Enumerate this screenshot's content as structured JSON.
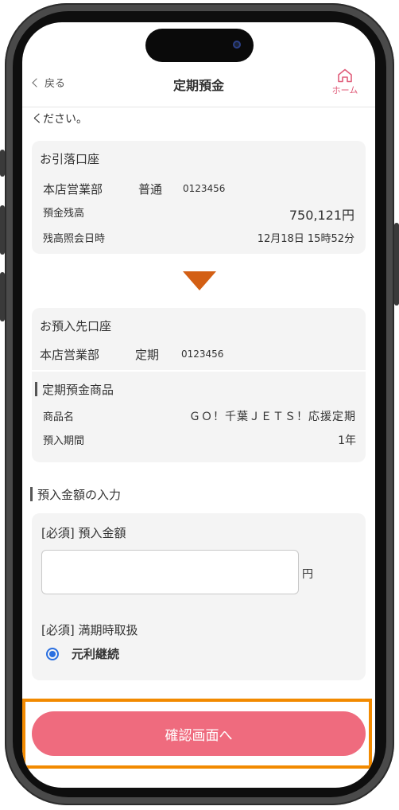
{
  "header": {
    "back_label": "戻る",
    "title": "定期預金",
    "home_label": "ホーム"
  },
  "lead_text": "ください。",
  "withdrawal": {
    "title": "お引落口座",
    "branch": "本店営業部",
    "account_type": "普通",
    "account_number": "0123456",
    "balance_label": "預金残高",
    "balance_value": "750,121円",
    "balance_time_label": "残高照会日時",
    "balance_time_value": "12月18日 15時52分"
  },
  "deposit_account": {
    "title": "お預入先口座",
    "branch": "本店営業部",
    "account_type": "定期",
    "account_number": "0123456"
  },
  "product": {
    "section_title": "定期預金商品",
    "name_label": "商品名",
    "name_value": "ＧＯ！千葉ＪＥＴＳ！応援定期",
    "period_label": "預入期間",
    "period_value": "1年"
  },
  "amount_section": {
    "section_title": "預入金額の入力",
    "required_tag": "[必須]",
    "amount_label": "預入金額",
    "amount_value": "",
    "amount_unit": "円",
    "maturity_label": "満期時取扱",
    "maturity_option": "元利継続"
  },
  "confirm_button": "確認画面へ",
  "colors": {
    "accent": "#ef6b7e",
    "arrow": "#d35f14",
    "highlight": "#f28a00",
    "radio": "#2a6fe0"
  }
}
